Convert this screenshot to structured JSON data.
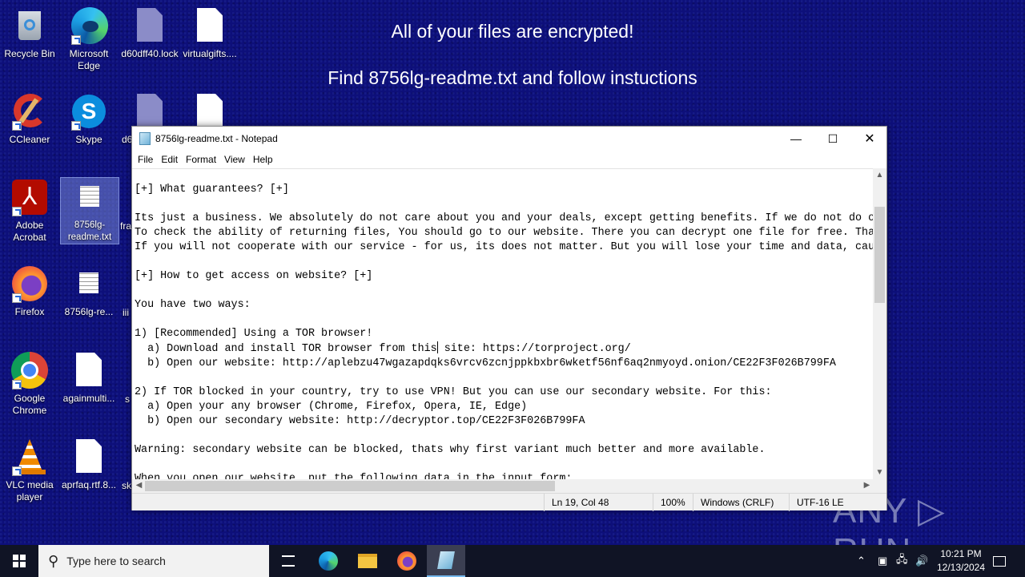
{
  "desktop": {
    "banner": {
      "line1": "All of your files are encrypted!",
      "line2": "Find 8756lg-readme.txt and follow instuctions"
    },
    "icons": [
      {
        "label": "Recycle Bin",
        "icon": "recycle-bin-icon"
      },
      {
        "label": "Microsoft Edge",
        "icon": "edge-icon"
      },
      {
        "label": "d60dff40.lock",
        "icon": "lock-file-icon"
      },
      {
        "label": "virtualgifts....",
        "icon": "file-icon"
      },
      {
        "label": "CCleaner",
        "icon": "ccleaner-icon"
      },
      {
        "label": "Skype",
        "icon": "skype-icon"
      },
      {
        "label": "d6",
        "icon": "lock-file-icon"
      },
      {
        "label": "",
        "icon": "file-icon"
      },
      {
        "label": "Adobe Acrobat",
        "icon": "acrobat-icon"
      },
      {
        "label": "8756lg-readme.txt",
        "icon": "text-file-icon"
      },
      {
        "label": "fra",
        "icon": "file-icon"
      },
      {
        "label": "Firefox",
        "icon": "firefox-icon"
      },
      {
        "label": "8756lg-re...",
        "icon": "text-file-icon"
      },
      {
        "label": "iii",
        "icon": "file-icon"
      },
      {
        "label": "Google Chrome",
        "icon": "chrome-icon"
      },
      {
        "label": "againmulti...",
        "icon": "file-icon"
      },
      {
        "label": "s",
        "icon": "file-icon"
      },
      {
        "label": "VLC media player",
        "icon": "vlc-icon"
      },
      {
        "label": "aprfaq.rtf.8...",
        "icon": "file-icon"
      },
      {
        "label": "sk",
        "icon": "file-icon"
      }
    ]
  },
  "notepad": {
    "title": "8756lg-readme.txt - Notepad",
    "controls": {
      "minimize": "—",
      "maximize": "☐",
      "close": "✕"
    },
    "menu": [
      "File",
      "Edit",
      "Format",
      "View",
      "Help"
    ],
    "lines": [
      "[+] What guarantees? [+]",
      "",
      "Its just a business. We absolutely do not care about you and your deals, except getting benefits. If we do not do o",
      "To check the ability of returning files, You should go to our website. There you can decrypt one file for free. Tha",
      "If you will not cooperate with our service - for us, its does not matter. But you will lose your time and data, cau",
      "",
      "[+] How to get access on website? [+]",
      "",
      "You have two ways:",
      "",
      "1) [Recommended] Using a TOR browser!",
      "  a) Download and install TOR browser from this| site: https://torproject.org/",
      "  b) Open our website: http://aplebzu47wgazapdqks6vrcv6zcnjppkbxbr6wketf56nf6aq2nmyoyd.onion/CE22F3F026B799FA",
      "",
      "2) If TOR blocked in your country, try to use VPN! But you can use our secondary website. For this:",
      "  a) Open your any browser (Chrome, Firefox, Opera, IE, Edge)",
      "  b) Open our secondary website: http://decryptor.top/CE22F3F026B799FA",
      "",
      "Warning: secondary website can be blocked, thats why first variant much better and more available.",
      "",
      "When you open our website, put the following data in the input form:"
    ],
    "status": {
      "position": "Ln 19, Col 48",
      "zoom": "100%",
      "line_ending": "Windows (CRLF)",
      "encoding": "UTF-16 LE"
    }
  },
  "watermark": "ANY ▷ RUN",
  "taskbar": {
    "search_placeholder": "Type here to search",
    "pinned": [
      "task-view",
      "edge",
      "file-explorer",
      "firefox",
      "notepad"
    ],
    "time": "10:21 PM",
    "date": "12/13/2024"
  },
  "colors": {
    "desktop_bg": "#0d0f7a",
    "taskbar_bg": "#101425",
    "accent": "#76b9ed"
  }
}
